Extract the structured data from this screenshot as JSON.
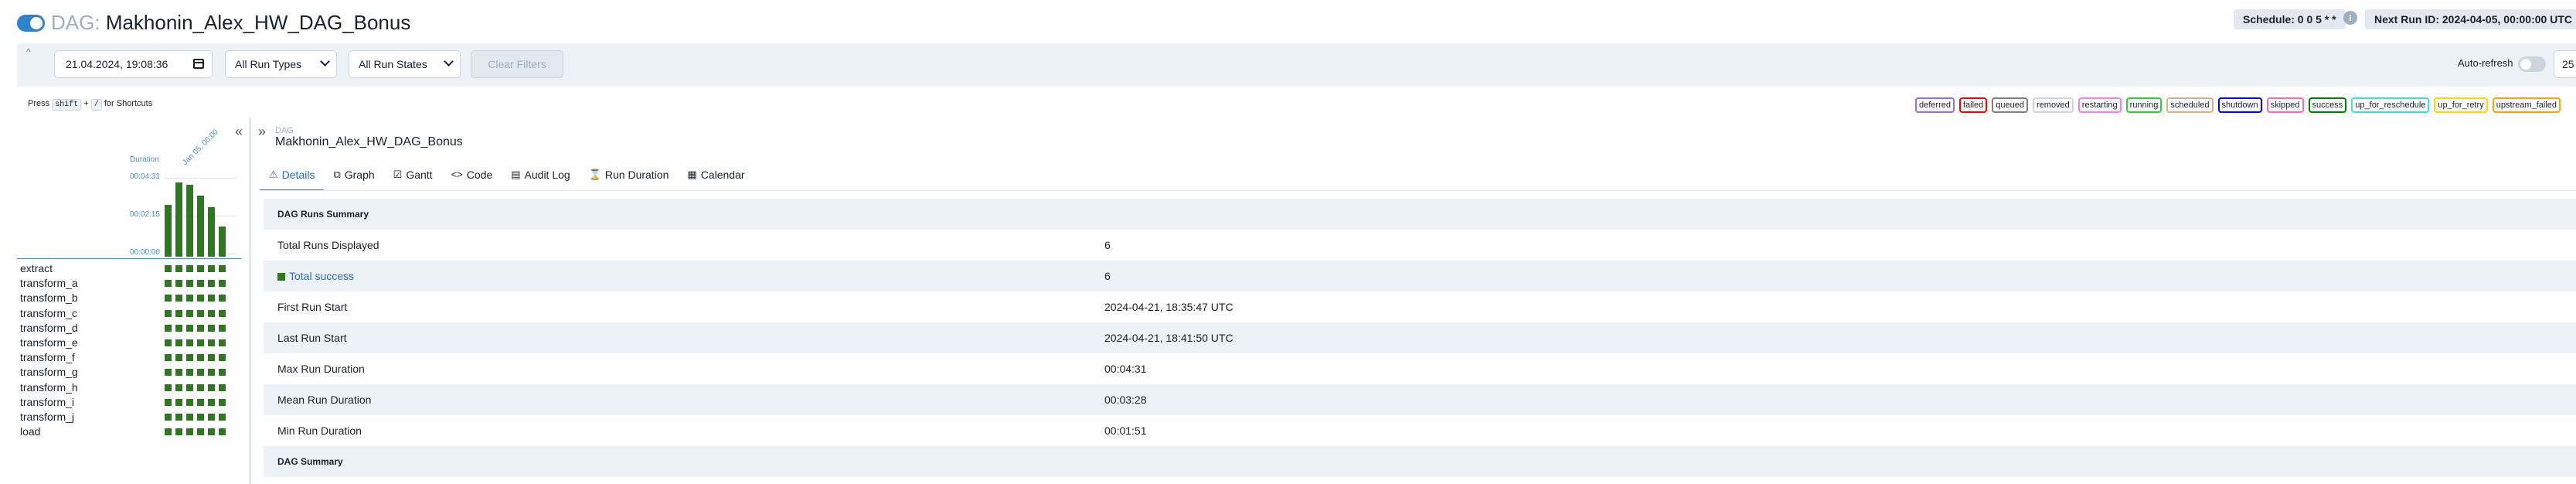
{
  "header": {
    "dag_prefix": "DAG:",
    "dag_id": "Makhonin_Alex_HW_DAG_Bonus",
    "schedule": "Schedule: 0 0 5 * *",
    "next_run": "Next Run ID: 2024-04-05, 00:00:00 UTC"
  },
  "filters": {
    "base_date": "21.04.2024, 19:08:36",
    "run_types": "All Run Types",
    "run_states": "All Run States",
    "clear_label": "Clear Filters",
    "autorefresh_label": "Auto-refresh",
    "page_size": "25"
  },
  "shortcuts": {
    "press": "Press",
    "shift": "shift",
    "plus": "+",
    "slash": "/",
    "suffix": "for Shortcuts"
  },
  "legend": [
    {
      "label": "deferred",
      "color": "#9370db"
    },
    {
      "label": "failed",
      "color": "#ff0000"
    },
    {
      "label": "queued",
      "color": "#808080"
    },
    {
      "label": "removed",
      "color": "#d3d3d3"
    },
    {
      "label": "restarting",
      "color": "#ee82ee"
    },
    {
      "label": "running",
      "color": "#32cd32"
    },
    {
      "label": "scheduled",
      "color": "#d2b48c"
    },
    {
      "label": "shutdown",
      "color": "#0000ff"
    },
    {
      "label": "skipped",
      "color": "#ff69b4"
    },
    {
      "label": "success",
      "color": "#008000"
    },
    {
      "label": "up_for_reschedule",
      "color": "#40e0d0"
    },
    {
      "label": "up_for_retry",
      "color": "#ffd700"
    },
    {
      "label": "upstream_failed",
      "color": "#ffa500"
    }
  ],
  "grid": {
    "duration_label": "Duration",
    "y_ticks": [
      "00:04:31",
      "00:02:15",
      "00:00:00"
    ],
    "run_date_label": "Jan 05, 00:00",
    "run_durations_sec": [
      188,
      271,
      262,
      224,
      180,
      111
    ],
    "max_duration_sec": 271,
    "tasks": [
      "extract",
      "transform_a",
      "transform_b",
      "transform_c",
      "transform_d",
      "transform_e",
      "transform_f",
      "transform_g",
      "transform_h",
      "transform_i",
      "transform_j",
      "load"
    ],
    "runs_per_task": 6
  },
  "main": {
    "dag_small": "DAG",
    "dag_name": "Makhonin_Alex_HW_DAG_Bonus",
    "tabs": [
      {
        "label": "Details",
        "icon": "⚠"
      },
      {
        "label": "Graph",
        "icon": "⧉"
      },
      {
        "label": "Gantt",
        "icon": "☑"
      },
      {
        "label": "Code",
        "icon": "<>"
      },
      {
        "label": "Audit Log",
        "icon": "▤"
      },
      {
        "label": "Run Duration",
        "icon": "⌛"
      },
      {
        "label": "Calendar",
        "icon": "▦"
      }
    ],
    "summary": {
      "runs_header": "DAG Runs Summary",
      "rows": [
        {
          "key": "Total Runs Displayed",
          "value": "6"
        },
        {
          "key": "Total success",
          "value": "6"
        },
        {
          "key": "First Run Start",
          "value": "2024-04-21, 18:35:47 UTC"
        },
        {
          "key": "Last Run Start",
          "value": "2024-04-21, 18:41:50 UTC"
        },
        {
          "key": "Max Run Duration",
          "value": "00:04:31"
        },
        {
          "key": "Mean Run Duration",
          "value": "00:03:28"
        },
        {
          "key": "Min Run Duration",
          "value": "00:01:51"
        }
      ],
      "dag_header": "DAG Summary"
    }
  }
}
